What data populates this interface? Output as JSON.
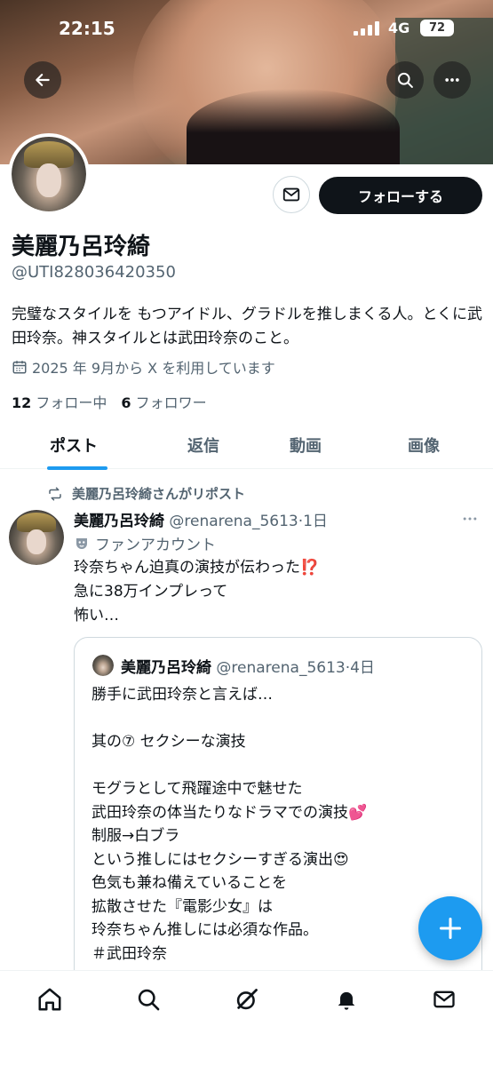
{
  "status_bar": {
    "time": "22:15",
    "network": "4G",
    "battery": "72"
  },
  "profile": {
    "name": "美麗乃呂玲綺",
    "handle": "@UTI828036420350",
    "bio": "完璧なスタイルを もつアイドル、グラドルを推しまくる人。とくに武田玲奈。神スタイルとは武田玲奈のこと。",
    "joined": "2025 年 9月から X を利用しています",
    "following_count": "12",
    "following_label": "フォロー中",
    "followers_count": "6",
    "followers_label": "フォロワー",
    "follow_button": "フォローする"
  },
  "tabs": [
    {
      "label": "ポスト",
      "active": true
    },
    {
      "label": "返信"
    },
    {
      "label": "動画"
    },
    {
      "label": "画像"
    }
  ],
  "post": {
    "repost_label": "美麗乃呂玲綺さんがリポスト",
    "author": "美麗乃呂玲綺",
    "meta": "@renarena_5613·1日",
    "fan_label": "ファンアカウント",
    "body": "玲奈ちゃん迫真の演技が伝わった⁉️\n急に38万インプレって\n怖い…",
    "quote": {
      "author": "美麗乃呂玲綺",
      "meta": "@renarena_5613·4日",
      "body": "勝手に武田玲奈と言えば…\n\n其の⑦ セクシーな演技\n\nモグラとして飛躍途中で魅せた\n武田玲奈の体当たりなドラマでの演技💕\n制服→白ブラ\nという推しにはセクシーすぎる演出😍\n色気も兼ね備えていることを\n拡散させた『電影少女』は\n玲奈ちゃん推しには必須な作品。\n＃武田玲奈"
    }
  },
  "icons": {
    "back": "arrow-left-icon",
    "search": "search-icon",
    "more": "more-horizontal-icon",
    "message": "envelope-icon",
    "calendar": "calendar-icon",
    "repost": "repost-icon",
    "fan": "mask-icon",
    "compose": "plus-icon",
    "nav": [
      "home-icon",
      "search-icon",
      "grok-icon",
      "bell-icon",
      "envelope-icon"
    ]
  },
  "colors": {
    "accent": "#1d9bf0",
    "text": "#0f1419",
    "secondary": "#536471"
  }
}
